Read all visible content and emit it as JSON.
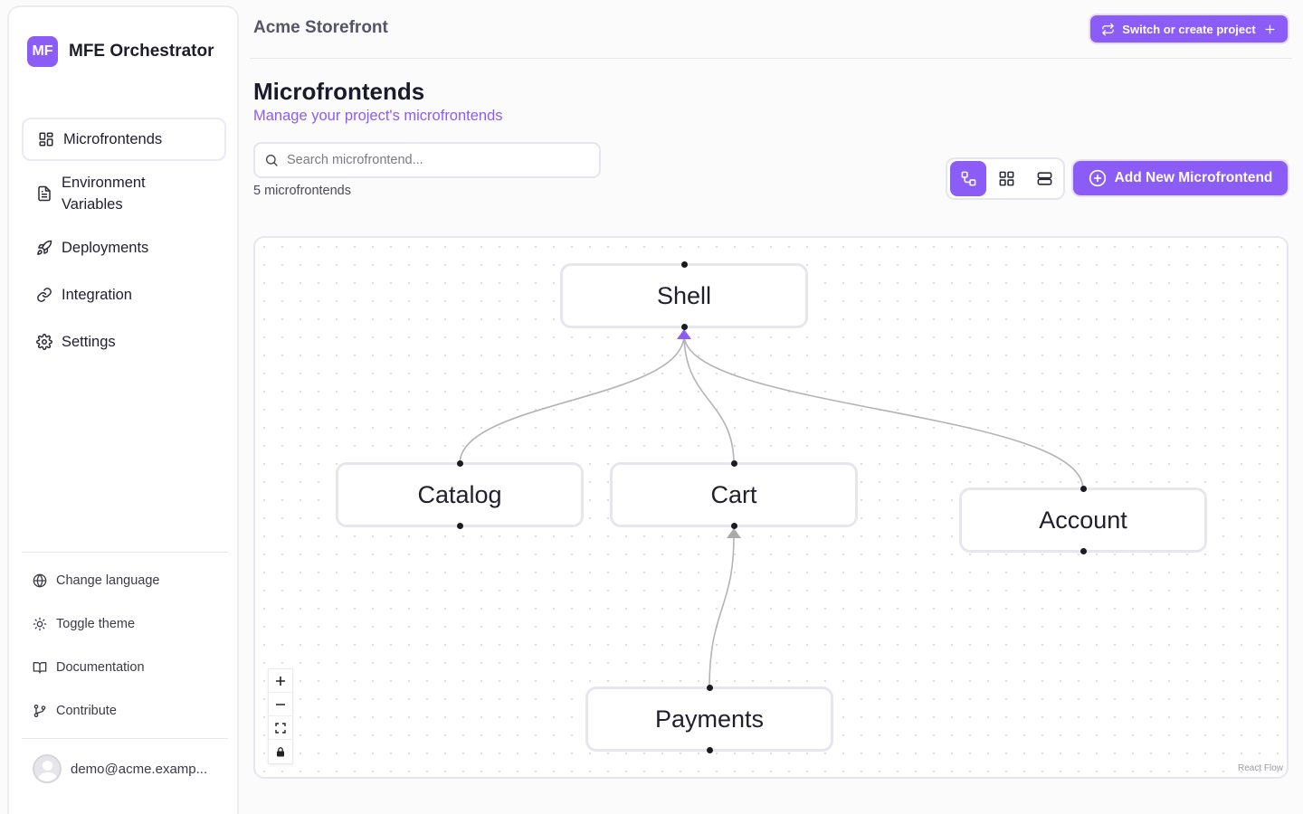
{
  "app": {
    "logo_text": "MF",
    "name": "MFE Orchestrator",
    "accent_color": "#8b5cf6"
  },
  "sidebar": {
    "items": [
      {
        "label": "Microfrontends",
        "icon": "layout-dashboard-icon",
        "active": true
      },
      {
        "label": "Environment Variables",
        "icon": "file-text-icon",
        "active": false
      },
      {
        "label": "Deployments",
        "icon": "rocket-icon",
        "active": false
      },
      {
        "label": "Integration",
        "icon": "link-icon",
        "active": false
      },
      {
        "label": "Settings",
        "icon": "gear-icon",
        "active": false
      }
    ],
    "utilities": [
      {
        "label": "Change language",
        "icon": "globe-icon"
      },
      {
        "label": "Toggle theme",
        "icon": "sun-icon"
      },
      {
        "label": "Documentation",
        "icon": "book-open-icon"
      },
      {
        "label": "Contribute",
        "icon": "git-branch-icon"
      }
    ],
    "user": {
      "email": "demo@acme.examp..."
    }
  },
  "header": {
    "project_name": "Acme Storefront",
    "switch_label": "Switch or create project"
  },
  "main": {
    "title": "Microfrontends",
    "subtitle": "Manage your project's microfrontends",
    "search_placeholder": "Search microfrontend...",
    "count_text": "5 microfrontends",
    "view_modes": [
      {
        "name": "graph",
        "icon": "graph-view-icon",
        "active": true
      },
      {
        "name": "grid",
        "icon": "grid-view-icon",
        "active": false
      },
      {
        "name": "list",
        "icon": "list-view-icon",
        "active": false
      }
    ],
    "add_label": "Add New Microfrontend"
  },
  "flow": {
    "nodes": [
      {
        "id": "shell",
        "label": "Shell"
      },
      {
        "id": "catalog",
        "label": "Catalog"
      },
      {
        "id": "cart",
        "label": "Cart"
      },
      {
        "id": "account",
        "label": "Account"
      },
      {
        "id": "payments",
        "label": "Payments"
      }
    ],
    "edges": [
      {
        "from": "catalog",
        "to": "shell",
        "highlighted": false
      },
      {
        "from": "cart",
        "to": "shell",
        "highlighted": true
      },
      {
        "from": "account",
        "to": "shell",
        "highlighted": false
      },
      {
        "from": "payments",
        "to": "cart",
        "highlighted": false
      }
    ],
    "controls": [
      "zoom-in",
      "zoom-out",
      "fit-view",
      "lock"
    ],
    "attribution": "React Flow"
  }
}
